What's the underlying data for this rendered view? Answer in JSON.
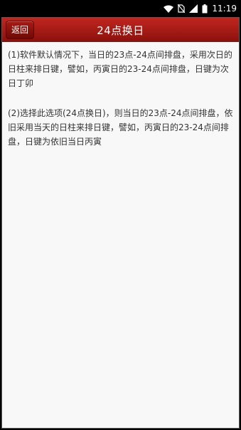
{
  "status_bar": {
    "time": "11:19",
    "icons": [
      "wifi-icon",
      "no-sim-icon",
      "signal-icon",
      "battery-icon"
    ]
  },
  "header": {
    "back_label": "返回",
    "title": "24点换日"
  },
  "content": {
    "paragraphs": [
      "(1)软件默认情况下，当日的23点-24点间排盘，采用次日的日柱来排日键，譬如，丙寅日的23-24点间排盘，日键为次日丁卯",
      "(2)选择此选项(24点换日)，则当日的23点-24点间排盘，依旧采用当天的日柱来排日键，譬如，丙寅日的23-24点间排盘，日键为依旧当日丙寅"
    ]
  },
  "colors": {
    "header_top": "#c2261f",
    "header_bottom": "#8a100c",
    "body_bg": "#f8f8f8",
    "text": "#333333"
  }
}
